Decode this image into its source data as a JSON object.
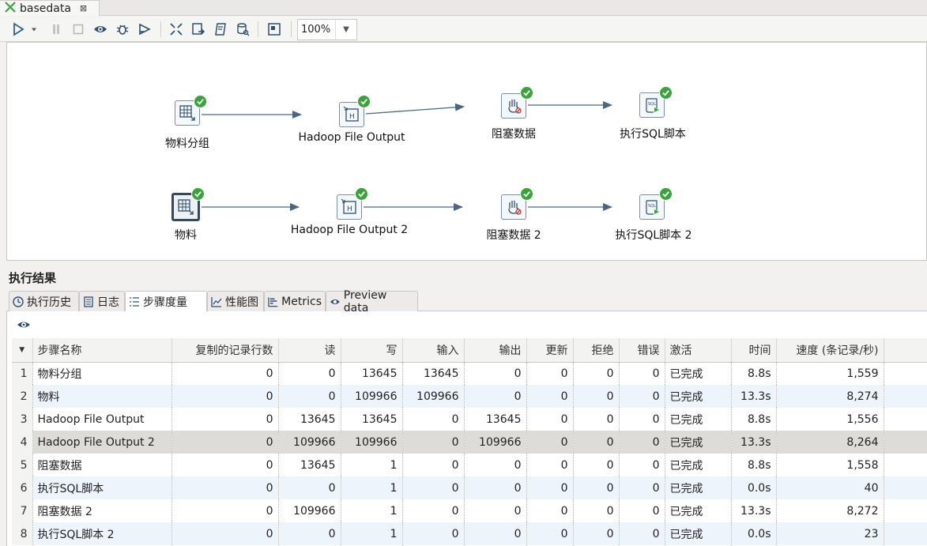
{
  "tab": {
    "title": "basedata",
    "close_icon": "close-icon"
  },
  "toolbar": {
    "zoom": "100%"
  },
  "canvas": {
    "nodes": [
      {
        "label": "物料分组",
        "icon": "group-by-icon"
      },
      {
        "label": "Hadoop File Output",
        "icon": "hadoop-output-icon"
      },
      {
        "label": "阻塞数据",
        "icon": "blocking-step-icon"
      },
      {
        "label": "执行SQL脚本",
        "icon": "sql-script-icon"
      },
      {
        "label": "物料",
        "icon": "table-input-icon"
      },
      {
        "label": "Hadoop File Output 2",
        "icon": "hadoop-output-icon"
      },
      {
        "label": "阻塞数据 2",
        "icon": "blocking-step-icon"
      },
      {
        "label": "执行SQL脚本 2",
        "icon": "sql-script-icon"
      }
    ],
    "status_color": "#3aa33a",
    "hop_color": "#4a6680"
  },
  "results": {
    "title": "执行结果",
    "tabs": [
      {
        "label": "执行历史"
      },
      {
        "label": "日志"
      },
      {
        "label": "步骤度量"
      },
      {
        "label": "性能图"
      },
      {
        "label": "Metrics"
      },
      {
        "label": "Preview data"
      }
    ],
    "columns": [
      "步骤名称",
      "复制的记录行数",
      "读",
      "写",
      "输入",
      "输出",
      "更新",
      "拒绝",
      "错误",
      "激活",
      "时间",
      "速度 (条记录/秒)"
    ],
    "rows": [
      {
        "n": "1",
        "name": "物料分组",
        "copy": "0",
        "read": "0",
        "write": "13645",
        "input": "13645",
        "output": "0",
        "update": "0",
        "reject": "0",
        "error": "0",
        "active": "已完成",
        "time": "8.8s",
        "speed": "1,559"
      },
      {
        "n": "2",
        "name": "物料",
        "copy": "0",
        "read": "0",
        "write": "109966",
        "input": "109966",
        "output": "0",
        "update": "0",
        "reject": "0",
        "error": "0",
        "active": "已完成",
        "time": "13.3s",
        "speed": "8,274"
      },
      {
        "n": "3",
        "name": "Hadoop File Output",
        "copy": "0",
        "read": "13645",
        "write": "13645",
        "input": "0",
        "output": "13645",
        "update": "0",
        "reject": "0",
        "error": "0",
        "active": "已完成",
        "time": "8.8s",
        "speed": "1,556"
      },
      {
        "n": "4",
        "name": "Hadoop File Output 2",
        "copy": "0",
        "read": "109966",
        "write": "109966",
        "input": "0",
        "output": "109966",
        "update": "0",
        "reject": "0",
        "error": "0",
        "active": "已完成",
        "time": "13.3s",
        "speed": "8,264"
      },
      {
        "n": "5",
        "name": "阻塞数据",
        "copy": "0",
        "read": "13645",
        "write": "1",
        "input": "0",
        "output": "0",
        "update": "0",
        "reject": "0",
        "error": "0",
        "active": "已完成",
        "time": "8.8s",
        "speed": "1,558"
      },
      {
        "n": "6",
        "name": "执行SQL脚本",
        "copy": "0",
        "read": "0",
        "write": "1",
        "input": "0",
        "output": "0",
        "update": "0",
        "reject": "0",
        "error": "0",
        "active": "已完成",
        "time": "0.0s",
        "speed": "40"
      },
      {
        "n": "7",
        "name": "阻塞数据 2",
        "copy": "0",
        "read": "109966",
        "write": "1",
        "input": "0",
        "output": "0",
        "update": "0",
        "reject": "0",
        "error": "0",
        "active": "已完成",
        "time": "13.3s",
        "speed": "8,272"
      },
      {
        "n": "8",
        "name": "执行SQL脚本 2",
        "copy": "0",
        "read": "0",
        "write": "1",
        "input": "0",
        "output": "0",
        "update": "0",
        "reject": "0",
        "error": "0",
        "active": "已完成",
        "time": "0.0s",
        "speed": "23"
      }
    ]
  }
}
